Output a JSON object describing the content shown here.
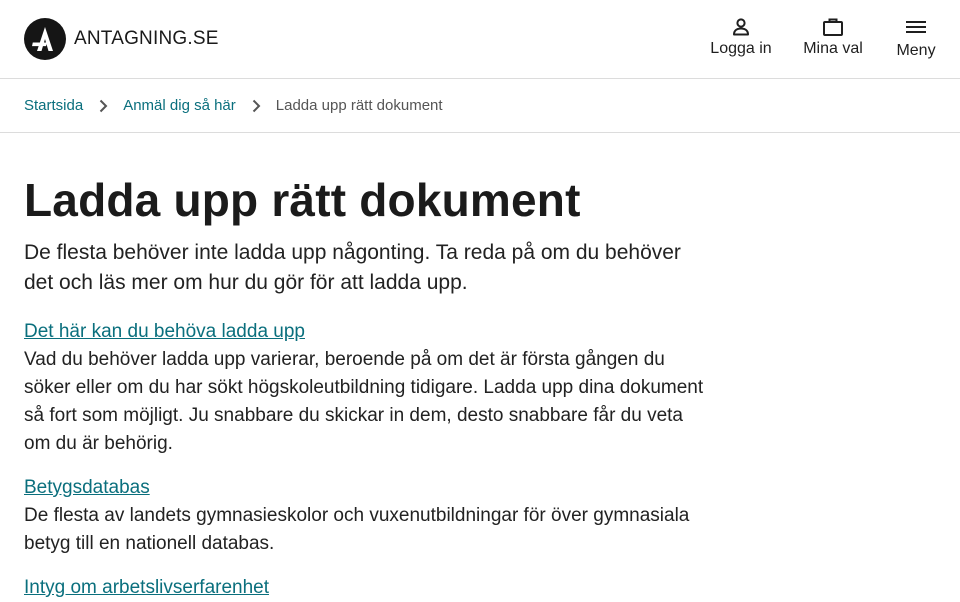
{
  "header": {
    "logo_text": "ANTAGNING.SE",
    "nav": {
      "login_label": "Logga in",
      "my_choices_label": "Mina val",
      "menu_label": "Meny"
    }
  },
  "breadcrumbs": {
    "items": [
      {
        "label": "Startsida"
      },
      {
        "label": "Anmäl dig så här"
      },
      {
        "label": "Ladda upp rätt dokument"
      }
    ]
  },
  "main": {
    "title": "Ladda upp rätt dokument",
    "lead": "De flesta behöver inte ladda upp någonting. Ta reda på om du behöver det och läs mer om hur du gör för att ladda upp.",
    "sections": [
      {
        "link": "Det här kan du behöva ladda upp",
        "text": "Vad du behöver ladda upp varierar, beroende på om det är första gången du söker eller om du har sökt högskoleutbildning tidigare. Ladda upp dina dokument så fort som möjligt. Ju snabbare du skickar in dem, desto snabbare får du veta om du är behörig."
      },
      {
        "link": "Betygsdatabas",
        "text": "De flesta av landets gymnasieskolor och vuxenutbildningar för över gymnasiala betyg till en nationell databas."
      },
      {
        "link": "Intyg om arbetslivserfarenhet",
        "text": ""
      }
    ]
  },
  "colors": {
    "link": "#0a6f7d",
    "text": "#1f1f1f",
    "border": "#dcdcdc"
  }
}
